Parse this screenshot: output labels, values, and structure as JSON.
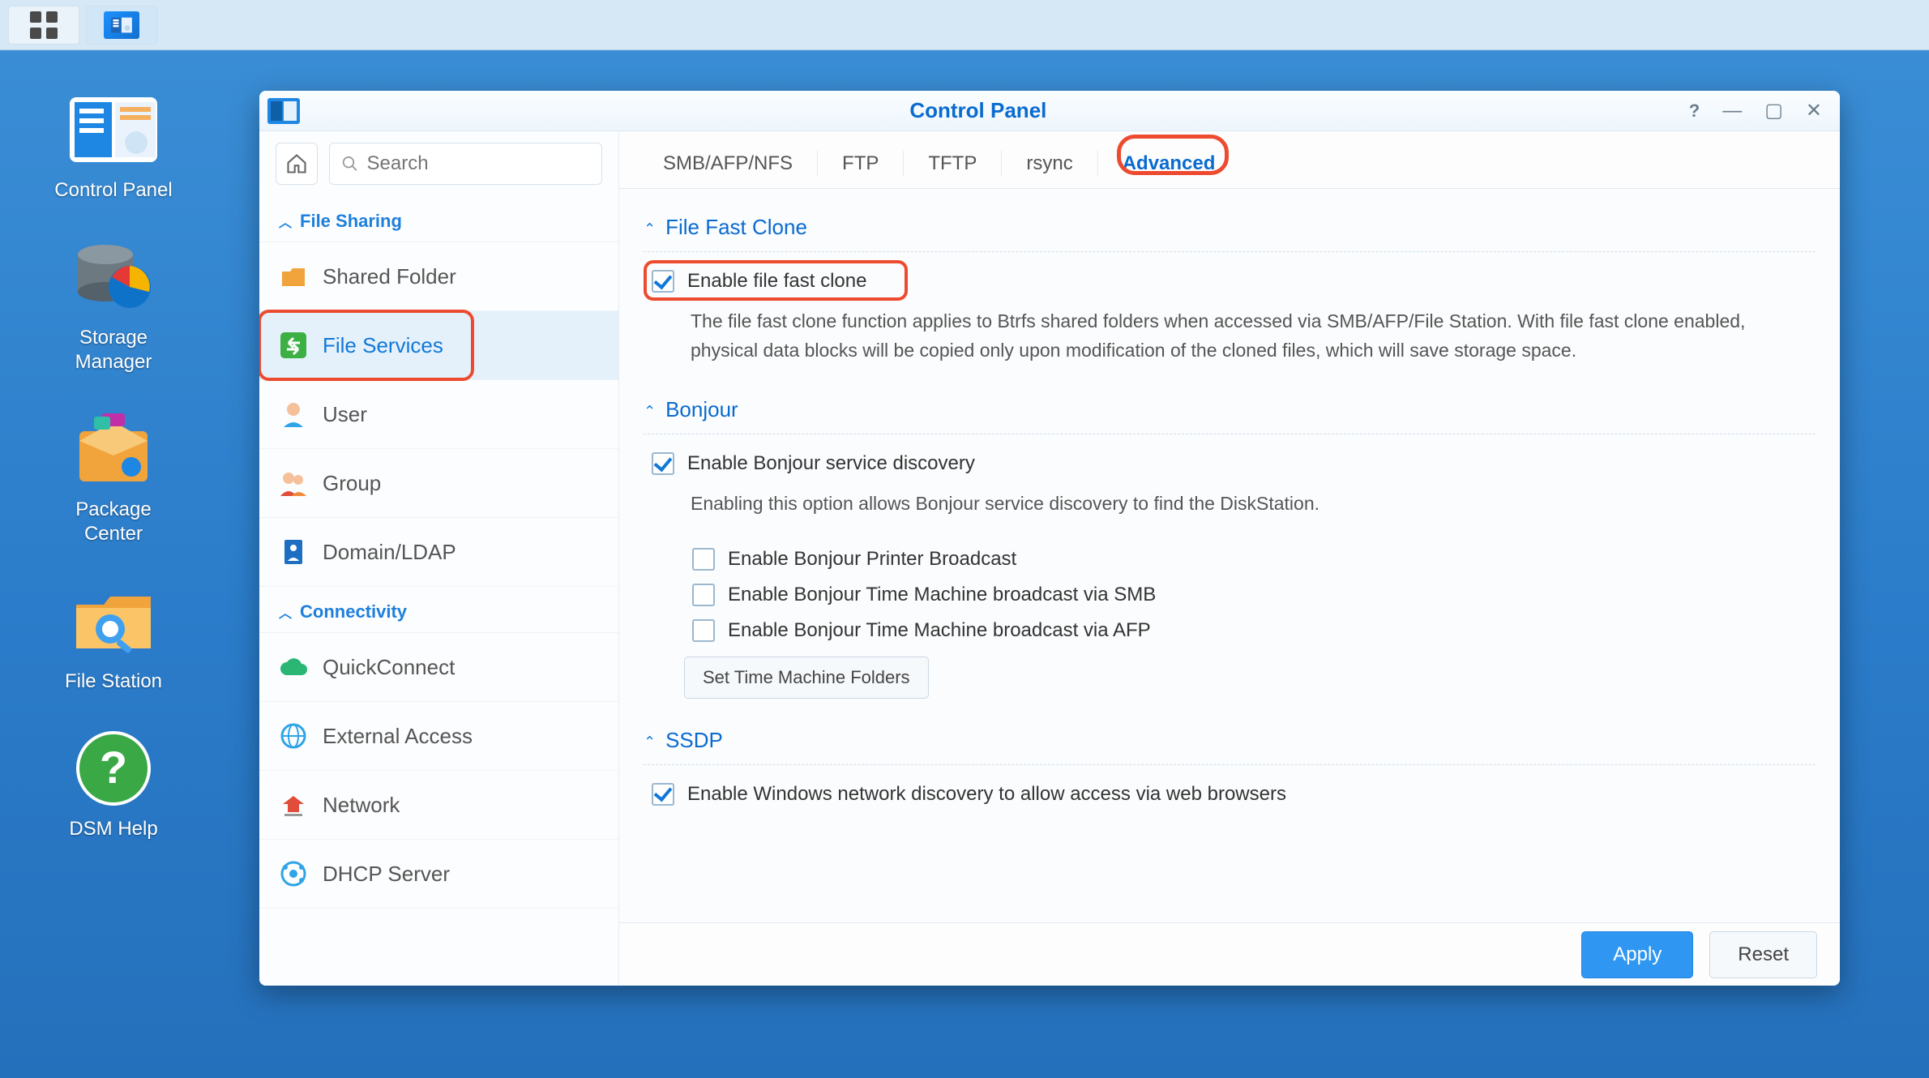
{
  "window": {
    "title": "Control Panel"
  },
  "search": {
    "placeholder": "Search"
  },
  "desktop": {
    "items": [
      {
        "label": "Control Panel"
      },
      {
        "label": "Storage\nManager"
      },
      {
        "label": "Package\nCenter"
      },
      {
        "label": "File Station"
      },
      {
        "label": "DSM Help"
      }
    ]
  },
  "sidebar": {
    "cat1": "File Sharing",
    "cat2": "Connectivity",
    "items": {
      "shared_folder": "Shared Folder",
      "file_services": "File Services",
      "user": "User",
      "group": "Group",
      "domain_ldap": "Domain/LDAP",
      "quickconnect": "QuickConnect",
      "external_access": "External Access",
      "network": "Network",
      "dhcp_server": "DHCP Server"
    }
  },
  "tabs": {
    "t0": "SMB/AFP/NFS",
    "t1": "FTP",
    "t2": "TFTP",
    "t3": "rsync",
    "t4": "Advanced"
  },
  "sections": {
    "fast_clone": {
      "title": "File Fast Clone",
      "cb": "Enable file fast clone",
      "desc": "The file fast clone function applies to Btrfs shared folders when accessed via SMB/AFP/File Station. With file fast clone enabled, physical data blocks will be copied only upon modification of the cloned files, which will save storage space."
    },
    "bonjour": {
      "title": "Bonjour",
      "cb": "Enable Bonjour service discovery",
      "desc": "Enabling this option allows Bonjour service discovery to find the DiskStation.",
      "sub1": "Enable Bonjour Printer Broadcast",
      "sub2": "Enable Bonjour Time Machine broadcast via SMB",
      "sub3": "Enable Bonjour Time Machine broadcast via AFP",
      "btn": "Set Time Machine Folders"
    },
    "ssdp": {
      "title": "SSDP",
      "cb": "Enable Windows network discovery to allow access via web browsers"
    }
  },
  "footer": {
    "apply": "Apply",
    "reset": "Reset"
  }
}
